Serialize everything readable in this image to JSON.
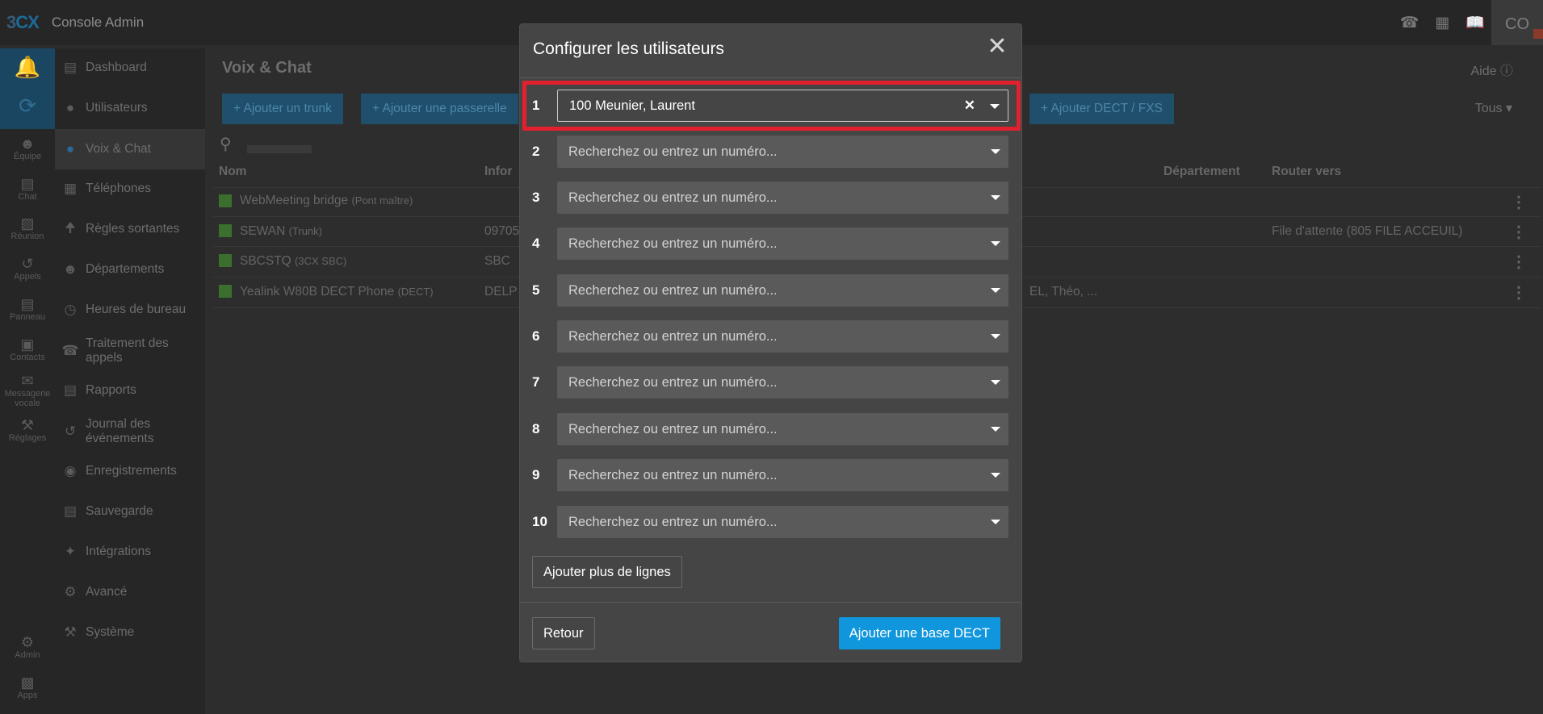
{
  "topbar": {
    "logo_prefix": "3",
    "logo_suffix": "CX",
    "app_title": "Console Admin",
    "icons": [
      "phone-icon",
      "qr-code-icon",
      "book-icon"
    ],
    "avatar_initials": "CO"
  },
  "rail": {
    "top_icons": [
      "bell-icon",
      "sync-icon"
    ],
    "items": [
      {
        "label": "Équipe",
        "icon": "team-icon"
      },
      {
        "label": "Chat",
        "icon": "chat-icon"
      },
      {
        "label": "Réunion",
        "icon": "meeting-icon"
      },
      {
        "label": "Appels",
        "icon": "history-icon"
      },
      {
        "label": "Panneau",
        "icon": "panel-icon"
      },
      {
        "label": "Contacts",
        "icon": "contacts-icon"
      },
      {
        "label": "Messagerie vocale",
        "icon": "voicemail-icon"
      },
      {
        "label": "Réglages",
        "icon": "wrench-icon"
      }
    ],
    "bottom_items": [
      {
        "label": "Admin",
        "icon": "gear-icon"
      },
      {
        "label": "Apps",
        "icon": "apps-icon"
      }
    ]
  },
  "nav": {
    "items": [
      {
        "label": "Dashboard",
        "icon": "dashboard-icon"
      },
      {
        "label": "Utilisateurs",
        "icon": "user-icon"
      },
      {
        "label": "Voix & Chat",
        "icon": "globe-icon",
        "active": true
      },
      {
        "label": "Téléphones",
        "icon": "phone-grid-icon"
      },
      {
        "label": "Règles sortantes",
        "icon": "arrow-up-icon"
      },
      {
        "label": "Départements",
        "icon": "group-icon"
      },
      {
        "label": "Heures de bureau",
        "icon": "clock-icon"
      },
      {
        "label": "Traitement des appels",
        "icon": "phone-icon"
      },
      {
        "label": "Rapports",
        "icon": "list-icon"
      },
      {
        "label": "Journal des événements",
        "icon": "history-icon"
      },
      {
        "label": "Enregistrements",
        "icon": "record-icon"
      },
      {
        "label": "Sauvegarde",
        "icon": "archive-icon"
      },
      {
        "label": "Intégrations",
        "icon": "puzzle-icon"
      },
      {
        "label": "Avancé",
        "icon": "cog-icon"
      },
      {
        "label": "Système",
        "icon": "wrench-icon"
      }
    ]
  },
  "main": {
    "title": "Voix & Chat",
    "help_label": "Aide",
    "toolbar": {
      "add_trunk": "+ Ajouter un trunk",
      "add_gateway": "+ Ajouter une passerelle",
      "add_dect": "+ Ajouter DECT / FXS",
      "filter": "Tous"
    },
    "table": {
      "headers": {
        "name": "Nom",
        "info": "Infor",
        "department": "Département",
        "route": "Router vers"
      },
      "rows": [
        {
          "name": "WebMeeting bridge",
          "tag": "(Pont maître)",
          "info": "",
          "extra": "",
          "route": ""
        },
        {
          "name": "SEWAN",
          "tag": "(Trunk)",
          "info": "09705",
          "extra": "",
          "route": "File d'attente (805 FILE ACCEUIL)"
        },
        {
          "name": "SBCSTQ",
          "tag": "(3CX SBC)",
          "info": "SBC",
          "extra": "",
          "route": ""
        },
        {
          "name": "Yealink W80B DECT Phone",
          "tag": "(DECT)",
          "info": "DELP",
          "extra": "EL, Théo, ...",
          "route": ""
        }
      ]
    }
  },
  "modal": {
    "title": "Configurer les utilisateurs",
    "close_icon": "close-icon",
    "lines": [
      {
        "num": "1",
        "value": "100 Meunier, Laurent",
        "filled": true
      },
      {
        "num": "2",
        "value": "Recherchez ou entrez un numéro...",
        "filled": false
      },
      {
        "num": "3",
        "value": "Recherchez ou entrez un numéro...",
        "filled": false
      },
      {
        "num": "4",
        "value": "Recherchez ou entrez un numéro...",
        "filled": false
      },
      {
        "num": "5",
        "value": "Recherchez ou entrez un numéro...",
        "filled": false
      },
      {
        "num": "6",
        "value": "Recherchez ou entrez un numéro...",
        "filled": false
      },
      {
        "num": "7",
        "value": "Recherchez ou entrez un numéro...",
        "filled": false
      },
      {
        "num": "8",
        "value": "Recherchez ou entrez un numéro...",
        "filled": false
      },
      {
        "num": "9",
        "value": "Recherchez ou entrez un numéro...",
        "filled": false
      },
      {
        "num": "10",
        "value": "Recherchez ou entrez un numéro...",
        "filled": false
      }
    ],
    "add_lines_label": "Ajouter plus de lignes",
    "back_label": "Retour",
    "submit_label": "Ajouter une base DECT",
    "colors": {
      "primary": "#0f96dc",
      "highlight": "#e3202d"
    }
  }
}
